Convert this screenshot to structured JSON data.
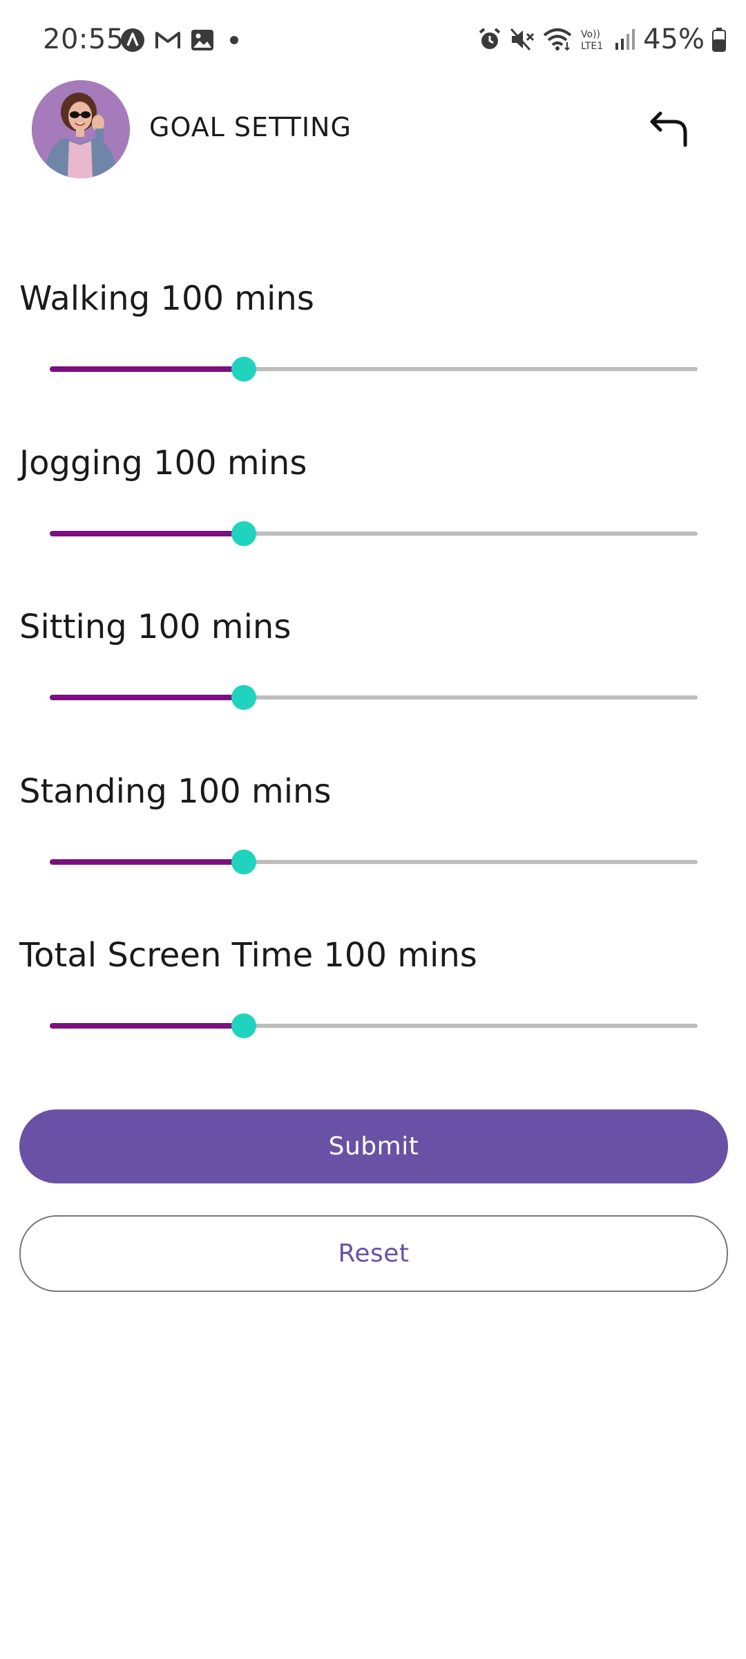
{
  "status_bar": {
    "time": "20:55",
    "left_icons": [
      "app-a-icon",
      "gmail-icon",
      "gallery-icon",
      "notification-dot-icon"
    ],
    "right_icons": [
      "alarm-icon",
      "mute-icon",
      "wifi-icon",
      "volte-icon",
      "signal-icon",
      "battery-icon"
    ],
    "volte_text": "Vo)) LTE1",
    "battery_percent": "45%"
  },
  "header": {
    "title": "GOAL SETTING",
    "avatar_icon": "profile-avatar",
    "back_icon": "undo-arrow-icon"
  },
  "goals": [
    {
      "label": "Walking 100 mins",
      "value": 0.3
    },
    {
      "label": "Jogging 100 mins",
      "value": 0.3
    },
    {
      "label": "Sitting 100 mins",
      "value": 0.3
    },
    {
      "label": "Standing 100 mins",
      "value": 0.3
    },
    {
      "label": "Total Screen Time 100 mins",
      "value": 0.3
    }
  ],
  "actions": {
    "submit_label": "Submit",
    "reset_label": "Reset"
  },
  "colors": {
    "slider_active": "#7b0f7f",
    "slider_thumb": "#1fd3bf",
    "slider_inactive": "#bdbdbd",
    "primary": "#6951a5"
  }
}
